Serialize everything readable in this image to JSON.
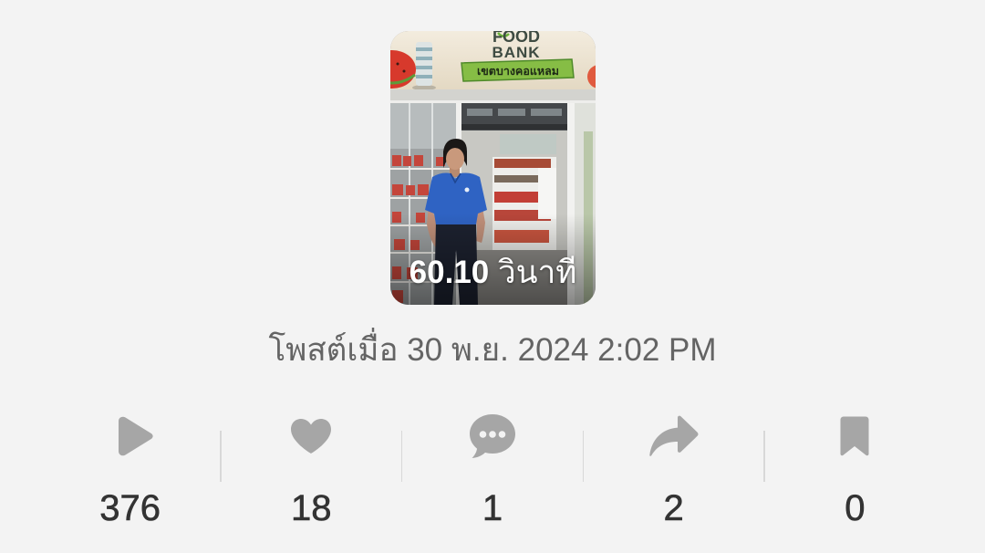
{
  "colors": {
    "background": "#f3f3f3",
    "posted_text": "#646464",
    "stat_icon": "#a6a6a6",
    "stat_value": "#333333",
    "divider": "#d8d8d8",
    "overlay_text": "#ffffff"
  },
  "video": {
    "duration_value": "60.10",
    "duration_unit": "วินาที",
    "sign_text_line1": "FOOD",
    "sign_text_line2": "BANK",
    "sign_banner_text": "เขตบางคอแหลม"
  },
  "posted": {
    "label": "โพสต์เมื่อ 30 พ.ย. 2024 2:02 PM"
  },
  "stats": [
    {
      "icon": "play-icon",
      "value": "376"
    },
    {
      "icon": "heart-icon",
      "value": "18"
    },
    {
      "icon": "comment-icon",
      "value": "1"
    },
    {
      "icon": "share-icon",
      "value": "2"
    },
    {
      "icon": "bookmark-icon",
      "value": "0"
    }
  ]
}
